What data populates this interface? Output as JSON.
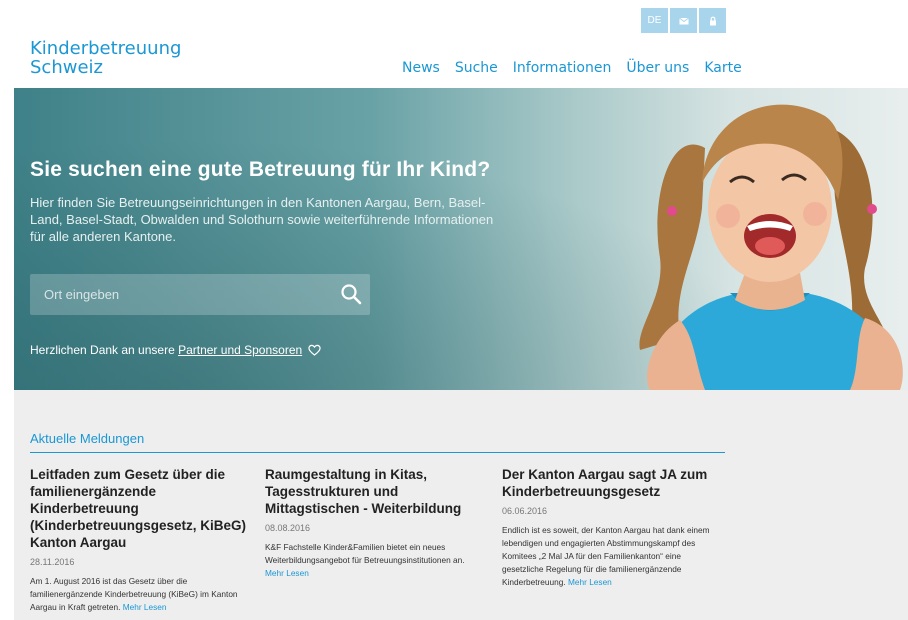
{
  "header": {
    "lang": "DE",
    "logo_line1": "Kinderbetreuung",
    "logo_line2": "Schweiz",
    "nav": [
      "News",
      "Suche",
      "Informationen",
      "Über uns",
      "Karte"
    ]
  },
  "hero": {
    "title": "Sie suchen eine gute Betreuung für Ihr Kind?",
    "lead": "Hier finden Sie Betreuungseinrichtungen in den Kantonen Aargau, Bern, Basel-Land, Basel-Stadt, Obwalden und Solothurn sowie weiterführende Informationen für alle anderen Kantone.",
    "search_placeholder": "Ort eingeben",
    "thanks_prefix": "Herzlichen Dank an unsere ",
    "thanks_link": "Partner und Sponsoren"
  },
  "news": {
    "heading": "Aktuelle Meldungen",
    "items": [
      {
        "title": "Leitfaden zum Gesetz über die familienergänzende Kinderbetreuung (Kinderbetreuungsgesetz, KiBeG) Kanton Aargau",
        "date": "28.11.2016",
        "text": "Am 1. August 2016 ist das Gesetz über die familienergänzende Kinderbetreuung (KiBeG) im Kanton Aargau in Kraft getreten.",
        "more": "Mehr Lesen"
      },
      {
        "title": "Raumgestaltung in Kitas, Tagesstrukturen und Mittagstischen - Weiterbildung",
        "date": "08.08.2016",
        "text": "K&F Fachstelle Kinder&Familien bietet ein neues Weiterbildungsangebot für Betreuungsinstitutionen an.",
        "more": "Mehr Lesen"
      },
      {
        "title": "Der Kanton Aargau sagt JA zum Kinderbetreuungsgesetz",
        "date": "06.06.2016",
        "text": "Endlich ist es soweit, der Kanton Aargau hat dank einem lebendigen und engagierten Abstimmungskampf des Komitees „2 Mal JA für den Familienkanton“ eine gesetzliche Regelung für die familienergänzende Kinderbetreuung.",
        "more": "Mehr Lesen"
      }
    ]
  },
  "icons": {
    "mail": "envelope-icon",
    "lock": "lock-icon",
    "search": "search-icon",
    "heart": "heart-icon"
  },
  "colors": {
    "brand": "#1b97d4",
    "topbar": "#a9d5ec",
    "news_bg": "#eeeeee"
  }
}
